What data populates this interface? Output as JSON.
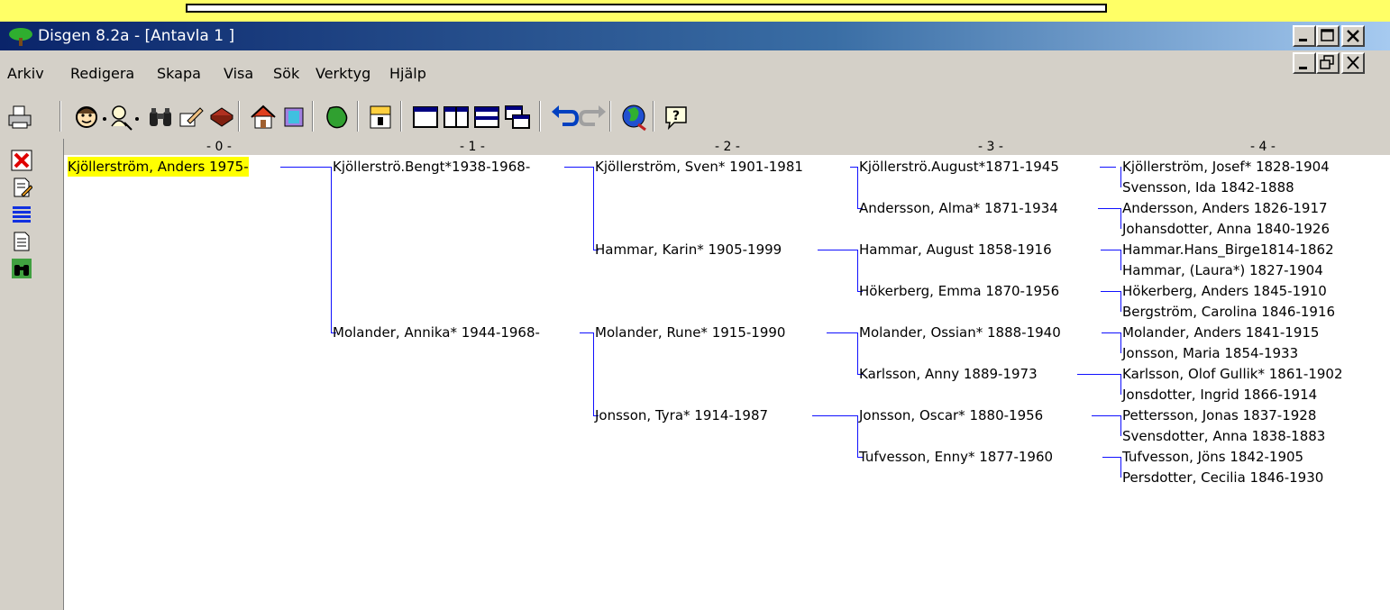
{
  "window": {
    "title": "Disgen 8.2a - [Antavla 1 ]"
  },
  "menu": [
    "Arkiv",
    "Redigera",
    "Skapa",
    "Visa",
    "Sök",
    "Verktyg",
    "Hjälp"
  ],
  "generations": [
    "- 0 -",
    "- 1 -",
    "- 2 -",
    "- 3 -",
    "- 4 -"
  ],
  "tree": {
    "g0": "Kjöllerström, Anders 1975-",
    "g1": [
      "Kjöllerströ.Bengt*1938-1968-",
      "Molander, Annika* 1944-1968-"
    ],
    "g2": [
      "Kjöllerström, Sven* 1901-1981",
      "Hammar, Karin* 1905-1999",
      "Molander, Rune* 1915-1990",
      "Jonsson, Tyra* 1914-1987"
    ],
    "g3": [
      "Kjöllerströ.August*1871-1945",
      "Andersson, Alma* 1871-1934",
      "Hammar, August 1858-1916",
      "Hökerberg, Emma 1870-1956",
      "Molander, Ossian* 1888-1940",
      "Karlsson, Anny 1889-1973",
      "Jonsson, Oscar* 1880-1956",
      "Tufvesson, Enny* 1877-1960"
    ],
    "g4": [
      "Kjöllerström, Josef* 1828-1904",
      "Svensson, Ida 1842-1888",
      "Andersson, Anders 1826-1917",
      "Johansdotter, Anna 1840-1926",
      "Hammar.Hans_Birge1814-1862",
      "Hammar, (Laura*) 1827-1904",
      "Hökerberg, Anders 1845-1910",
      "Bergström, Carolina 1846-1916",
      "Molander, Anders 1841-1915",
      "Jonsson, Maria 1854-1933",
      "Karlsson, Olof Gullik* 1861-1902",
      "Jonsdotter, Ingrid 1866-1914",
      "Pettersson, Jonas 1837-1928",
      "Svensdotter, Anna 1838-1883",
      "Tufvesson, Jöns 1842-1905",
      "Persdotter, Cecilia 1846-1930"
    ]
  },
  "colors": {
    "highlight": "#ffff00",
    "line": "#1010ff",
    "titlebar": "#0a246a",
    "background": "#ffff66"
  }
}
